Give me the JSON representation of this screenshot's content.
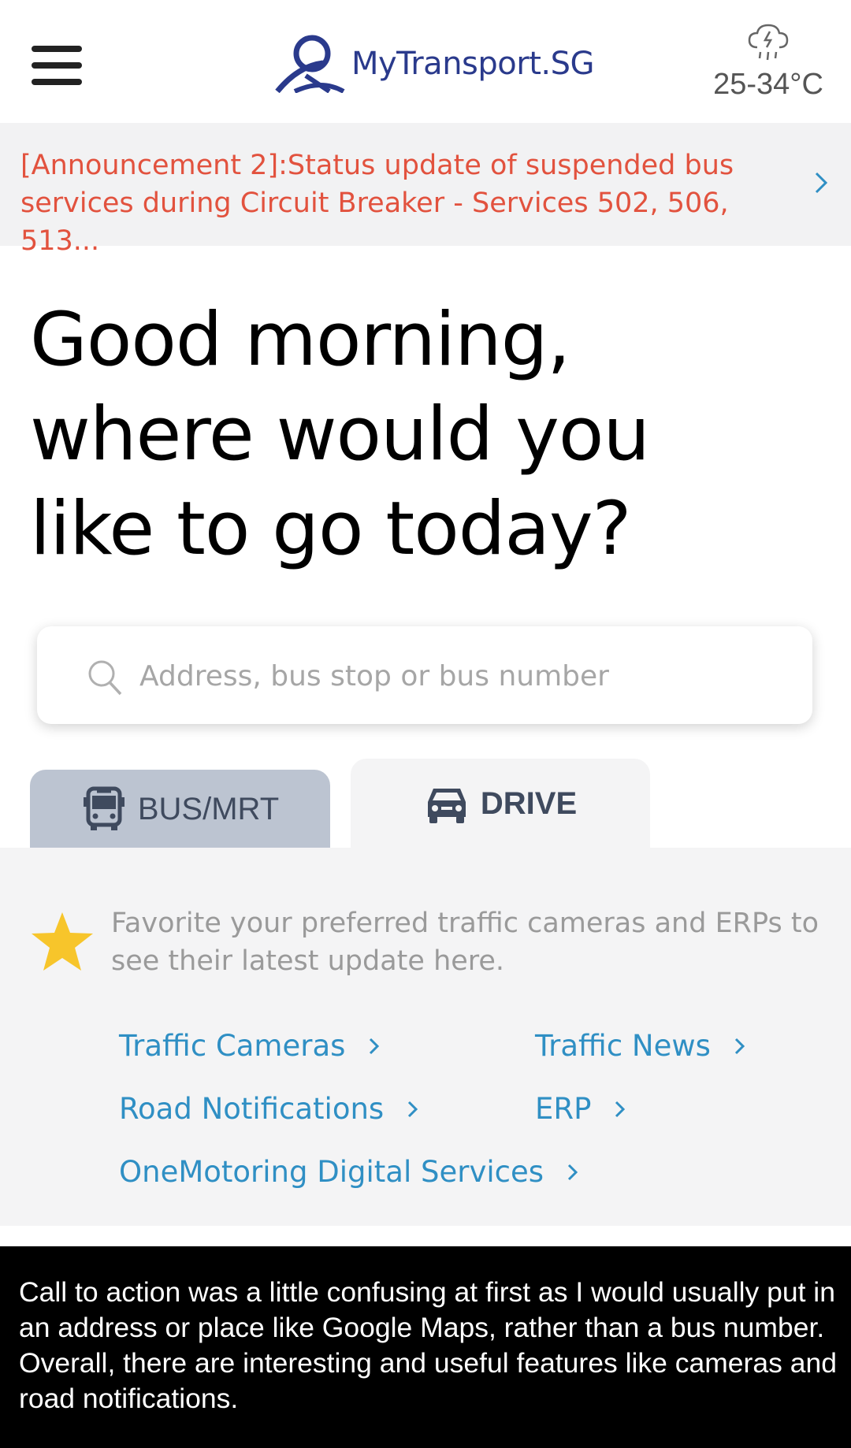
{
  "header": {
    "app_name": "MyTransport.SG",
    "weather_temp": "25-34°C",
    "weather_icon": "cloud-rain-lightning-icon",
    "menu_icon": "hamburger-menu-icon"
  },
  "announcement": {
    "text": "[Announcement 2]:Status update of suspended bus services during Circuit Breaker - Services 502, 506, 513...",
    "color": "#e2523e"
  },
  "greeting": {
    "line1": "Good morning,",
    "line2": "where would you",
    "line3": "like to go today?"
  },
  "search": {
    "placeholder": "Address, bus stop or bus number",
    "value": ""
  },
  "tabs": [
    {
      "label": "BUS/MRT",
      "icon": "bus-icon",
      "selected": false
    },
    {
      "label": "DRIVE",
      "icon": "car-icon",
      "selected": true
    }
  ],
  "drive_panel": {
    "favorite_hint": "Favorite your preferred traffic cameras and ERPs to see their latest update here.",
    "links": [
      {
        "label": "Traffic Cameras"
      },
      {
        "label": "Traffic News"
      },
      {
        "label": "Road Notifications"
      },
      {
        "label": "ERP"
      },
      {
        "label": "OneMotoring Digital Services"
      }
    ]
  },
  "caption": {
    "text": "Call to action was a little confusing at first as I would usually put in an address or place like Google Maps, rather than a bus number. Overall, there are interesting and useful features like cameras and road notifications."
  },
  "colors": {
    "accent_link": "#2f8fc4",
    "brand": "#2a3a8c",
    "star": "#f7c52b",
    "bus_tab_bg": "#bcc4d1"
  }
}
